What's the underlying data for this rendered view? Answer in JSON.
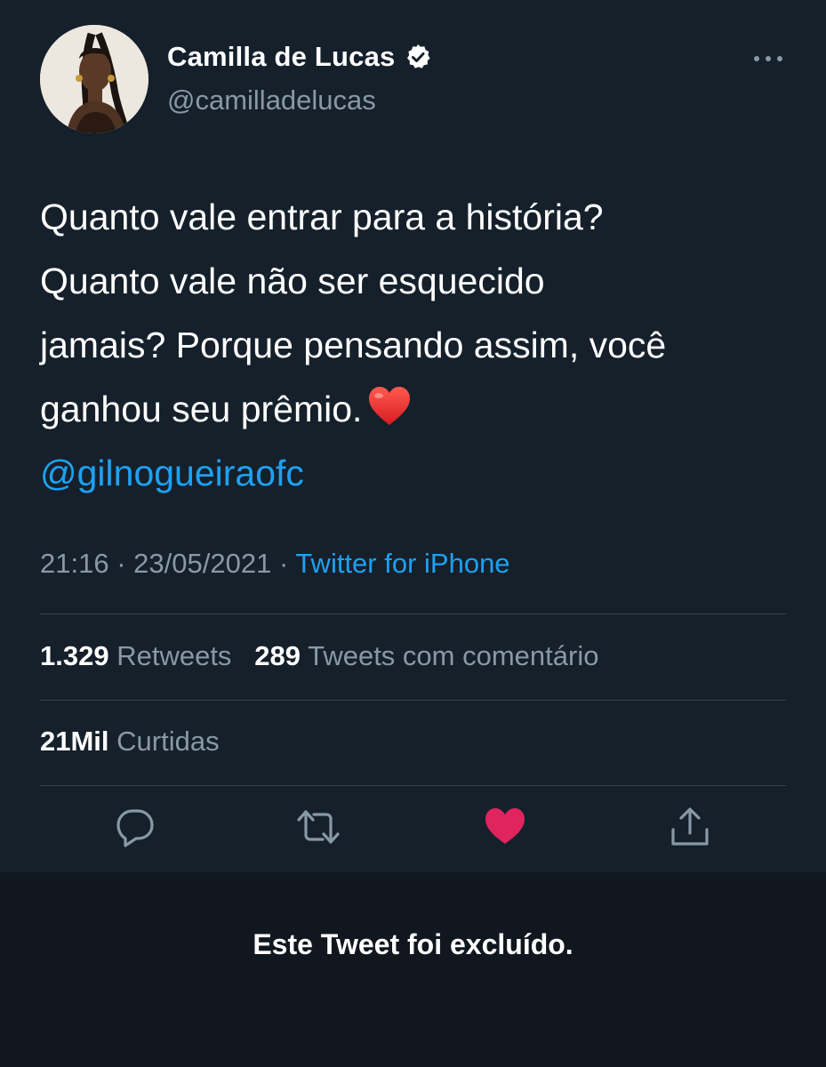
{
  "author": {
    "display_name": "Camilla de Lucas",
    "handle": "@camilladelucas",
    "verified": true
  },
  "tweet": {
    "lines": [
      "Quanto vale entrar para a história?",
      "Quanto vale não ser esquecido",
      "jamais? Porque pensando assim, você",
      "ganhou seu prêmio."
    ],
    "emoji": "red-heart",
    "mention": "@gilnogueiraofc"
  },
  "meta": {
    "time": "21:16",
    "separator": "·",
    "date": "23/05/2021",
    "source": "Twitter for iPhone"
  },
  "stats": {
    "retweets_count": "1.329",
    "retweets_label": "Retweets",
    "quotes_count": "289",
    "quotes_label": "Tweets com comentário",
    "likes_count": "21Mil",
    "likes_label": "Curtidas"
  },
  "actions": [
    {
      "icon": "reply-icon"
    },
    {
      "icon": "retweet-icon"
    },
    {
      "icon": "like-icon",
      "active": true
    },
    {
      "icon": "share-icon"
    }
  ],
  "deleted_notice": "Este Tweet foi excluído.",
  "colors": {
    "background": "#15202b",
    "accent": "#1da1f2",
    "muted": "#8899a6",
    "like": "#e0245e",
    "divider": "#38444d",
    "notice_bg": "#10171e"
  }
}
